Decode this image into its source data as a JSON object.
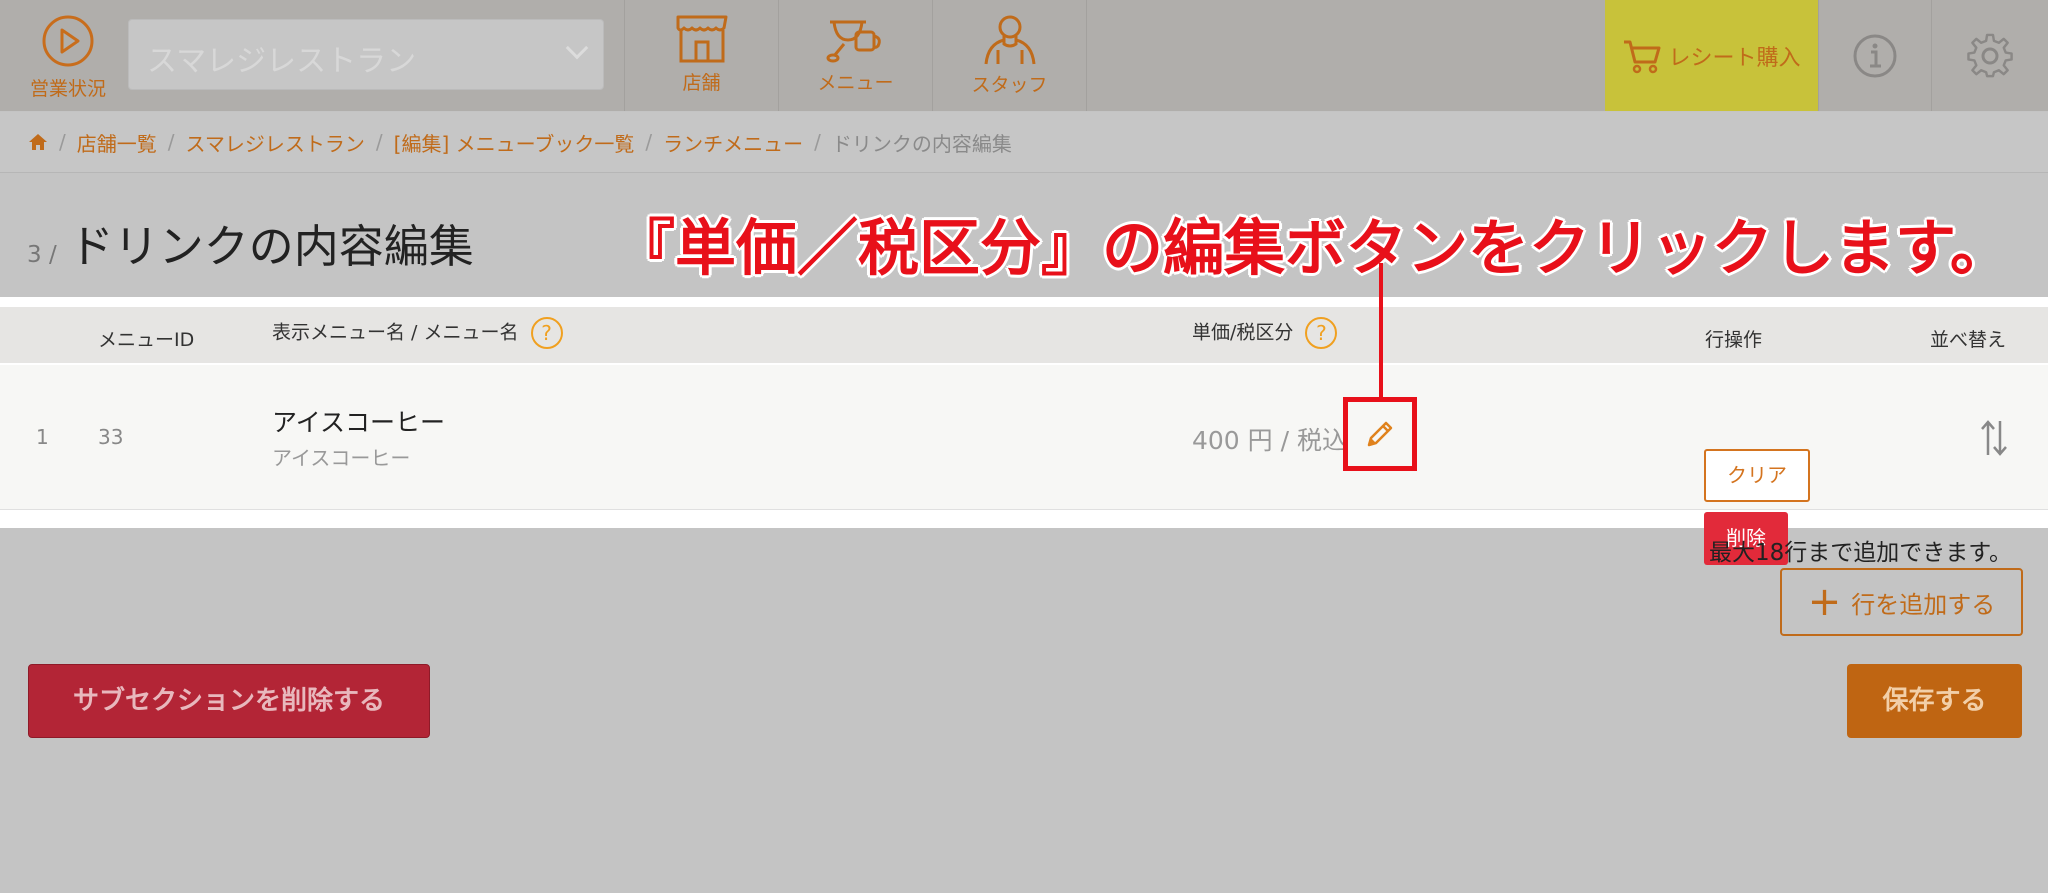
{
  "topbar": {
    "status_label": "営業状況",
    "store_select_value": "スマレジレストラン",
    "nav": [
      {
        "label": "店舗",
        "icon": "storefront-icon"
      },
      {
        "label": "メニュー",
        "icon": "cup-icon"
      },
      {
        "label": "スタッフ",
        "icon": "staff-icon"
      }
    ],
    "receipt_label": "レシート購入"
  },
  "breadcrumb": {
    "items": [
      "店舗一覧",
      "スマレジレストラン",
      "[編集] メニューブック一覧",
      "ランチメニュー"
    ],
    "current": "ドリンクの内容編集"
  },
  "page": {
    "number": "3 /",
    "title": "ドリンクの内容編集"
  },
  "annotation": "『単価／税区分』の編集ボタンをクリックします。",
  "table": {
    "headers": {
      "menu_id": "メニューID",
      "name": "表示メニュー名 / メニュー名",
      "price": "単価/税区分",
      "row_ops": "行操作",
      "sort": "並べ替え"
    },
    "help_mark": "?",
    "rows": [
      {
        "index": "1",
        "menu_id": "33",
        "display_name": "アイスコーヒー",
        "menu_name": "アイスコーヒー",
        "price": "400 円 / 税込",
        "clear_label": "クリア",
        "delete_label": "削除"
      }
    ]
  },
  "footer": {
    "max_note": "最大18行まで追加できます。",
    "add_row_label": "行を追加する",
    "add_row_plus": "+",
    "delete_subsection_label": "サブセクションを削除する",
    "save_label": "保存する"
  },
  "colors": {
    "accent": "#c06b1a",
    "danger": "#e22a3a",
    "annotation": "#e8101a",
    "receipt_bg": "#c8c23a"
  }
}
